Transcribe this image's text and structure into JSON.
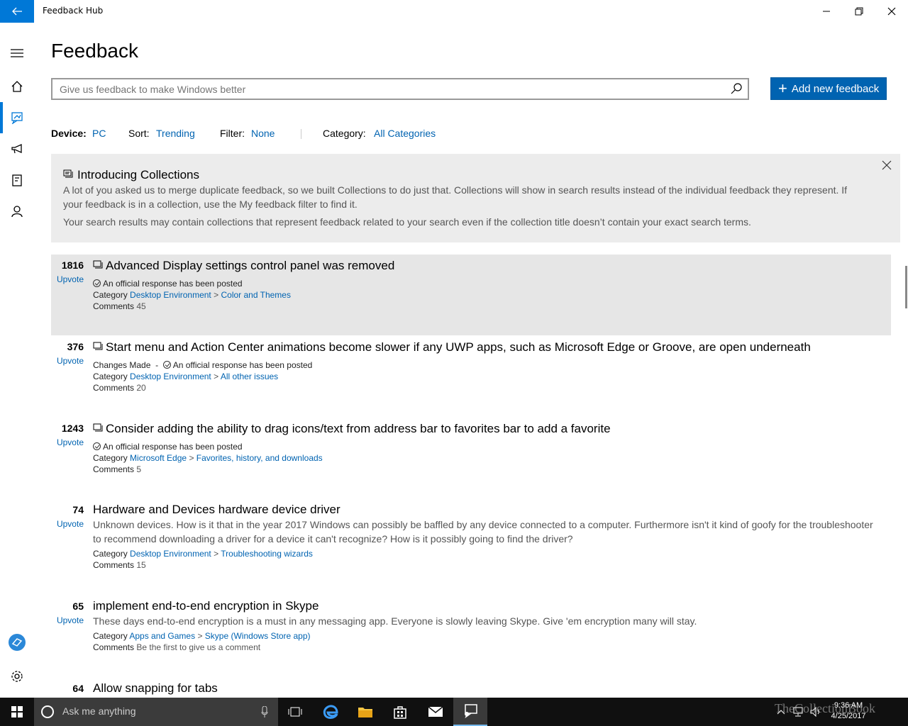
{
  "window": {
    "title": "Feedback Hub"
  },
  "page": {
    "title": "Feedback"
  },
  "search": {
    "placeholder": "Give us feedback to make Windows better"
  },
  "add_button": {
    "label": "Add new feedback"
  },
  "filters": {
    "device_label": "Device:",
    "device_value": "PC",
    "sort_label": "Sort:",
    "sort_value": "Trending",
    "filter_label": "Filter:",
    "filter_value": "None",
    "category_label": "Category:",
    "category_value": "All Categories"
  },
  "banner": {
    "title": "Introducing Collections",
    "line1": "A lot of you asked us to merge duplicate feedback, so we built Collections to do just that. Collections will show in search results instead of the individual feedback they represent. If your feedback is in a collection, use the My feedback filter to find it.",
    "line2": "Your search results may contain collections that represent feedback related to your search even if the collection title doesn’t contain your exact search terms."
  },
  "labels": {
    "upvote": "Upvote",
    "category": "Category",
    "comments": "Comments",
    "official": "An official response has been posted",
    "changes_made": "Changes Made",
    "dash": "-",
    "sep": ">"
  },
  "feedback": [
    {
      "votes": "1816",
      "title": "Advanced Display settings control panel was removed",
      "cat1": "Desktop Environment",
      "cat2": "Color and Themes",
      "comments": "45"
    },
    {
      "votes": "376",
      "title": "Start menu and Action Center animations become slower if any UWP apps, such as Microsoft Edge or Groove, are open underneath",
      "cat1": "Desktop Environment",
      "cat2": "All other issues",
      "comments": "20"
    },
    {
      "votes": "1243",
      "title": "Consider adding the ability to drag icons/text from address bar to favorites bar to add a favorite",
      "cat1": "Microsoft Edge",
      "cat2": "Favorites, history, and downloads",
      "comments": "5"
    },
    {
      "votes": "74",
      "title": "Hardware and Devices hardware device driver",
      "desc": "Unknown devices. How is it that in the year 2017 Windows can possibly be baffled by any device connected to a computer. Furthermore isn't it kind of goofy for the troubleshooter to recommend downloading a driver for a device it can't recognize? How is it possibly going to find the driver?",
      "cat1": "Desktop Environment",
      "cat2": "Troubleshooting wizards",
      "comments": "15"
    },
    {
      "votes": "65",
      "title": "implement end-to-end encryption in Skype",
      "desc": "These days end-to-end encryption is a must in any messaging app. Everyone is slowly leaving Skype. Give 'em encryption many will stay.",
      "cat1": "Apps and Games",
      "cat2": "Skype (Windows Store app)",
      "comments": "Be the first to give us a comment"
    },
    {
      "votes": "64",
      "title": "Allow snapping for tabs"
    }
  ],
  "taskbar": {
    "search_placeholder": "Ask me anything",
    "time": "9:36 AM",
    "date": "4/25/2017"
  },
  "watermark": "TheCollectionBook",
  "colors": {
    "accent": "#0078d7",
    "link": "#0063b1",
    "selected_row": "#e6e6e6",
    "banner_bg": "#ececec",
    "taskbar_bg": "#101010"
  }
}
